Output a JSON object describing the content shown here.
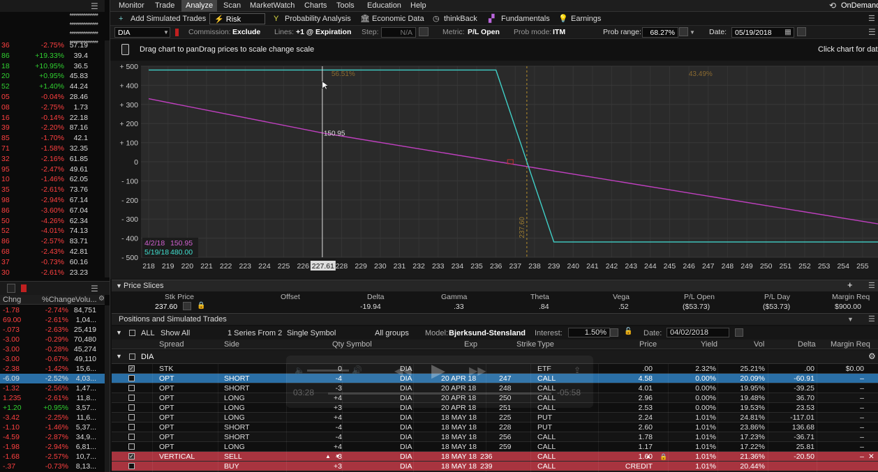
{
  "watchlist": {
    "top_rows": [
      "**************",
      "**************",
      "**************",
      "**************"
    ],
    "rows": [
      {
        "a": "36",
        "b": "-2.75%",
        "c": "57.19",
        "col": "red"
      },
      {
        "a": "86",
        "b": "+19.33%",
        "c": "39.4",
        "col": "green"
      },
      {
        "a": "18",
        "b": "+10.95%",
        "c": "36.5",
        "col": "green"
      },
      {
        "a": "20",
        "b": "+0.95%",
        "c": "45.83",
        "col": "green"
      },
      {
        "a": "52",
        "b": "+1.40%",
        "c": "44.24",
        "col": "green"
      },
      {
        "a": "05",
        "b": "-0.04%",
        "c": "28.46",
        "col": "red"
      },
      {
        "a": "08",
        "b": "-2.75%",
        "c": "1.73",
        "col": "red"
      },
      {
        "a": "16",
        "b": "-0.14%",
        "c": "22.18",
        "col": "red"
      },
      {
        "a": "39",
        "b": "-2.20%",
        "c": "87.16",
        "col": "red"
      },
      {
        "a": "85",
        "b": "-1.70%",
        "c": "42.1",
        "col": "red"
      },
      {
        "a": "71",
        "b": "-1.58%",
        "c": "32.35",
        "col": "red"
      },
      {
        "a": "32",
        "b": "-2.16%",
        "c": "61.85",
        "col": "red"
      },
      {
        "a": "95",
        "b": "-2.47%",
        "c": "49.61",
        "col": "red"
      },
      {
        "a": "10",
        "b": "-1.46%",
        "c": "62.05",
        "col": "red"
      },
      {
        "a": "35",
        "b": "-2.61%",
        "c": "73.76",
        "col": "red"
      },
      {
        "a": "98",
        "b": "-2.94%",
        "c": "67.14",
        "col": "red"
      },
      {
        "a": "86",
        "b": "-3.60%",
        "c": "67.04",
        "col": "red"
      },
      {
        "a": "50",
        "b": "-4.26%",
        "c": "62.34",
        "col": "red"
      },
      {
        "a": "52",
        "b": "-4.01%",
        "c": "74.13",
        "col": "red"
      },
      {
        "a": "86",
        "b": "-2.57%",
        "c": "83.71",
        "col": "red"
      },
      {
        "a": "68",
        "b": "-2.43%",
        "c": "42.81",
        "col": "red"
      },
      {
        "a": "37",
        "b": "-0.73%",
        "c": "60.16",
        "col": "red"
      },
      {
        "a": "30",
        "b": "-2.61%",
        "c": "23.23",
        "col": "red"
      }
    ],
    "headers": [
      "Chng",
      "%Change",
      "Volu..."
    ],
    "rows2": [
      {
        "a": "-1.78",
        "b": "-2.74%",
        "c": "84,751",
        "col": "red"
      },
      {
        "a": "69.00",
        "b": "-2.61%",
        "c": "1,04...",
        "col": "red"
      },
      {
        "a": "-.073",
        "b": "-2.63%",
        "c": "25,419",
        "col": "red"
      },
      {
        "a": "-3.00",
        "b": "-0.29%",
        "c": "70,480",
        "col": "red"
      },
      {
        "a": "-3.00",
        "b": "-0.28%",
        "c": "45,274",
        "col": "red"
      },
      {
        "a": "-3.00",
        "b": "-0.67%",
        "c": "49,110",
        "col": "red"
      },
      {
        "a": "-2.38",
        "b": "-1.42%",
        "c": "15,6...",
        "col": "red"
      },
      {
        "a": "-6.09",
        "b": "-2.52%",
        "c": "4,03...",
        "col": "red",
        "sel": true
      },
      {
        "a": "-1.32",
        "b": "-2.56%",
        "c": "1,47...",
        "col": "red"
      },
      {
        "a": "1.235",
        "b": "-2.61%",
        "c": "11,8...",
        "col": "red"
      },
      {
        "a": "+1.20",
        "b": "+0.95%",
        "c": "3,57...",
        "col": "green"
      },
      {
        "a": "-3.42",
        "b": "-2.25%",
        "c": "11,6...",
        "col": "red"
      },
      {
        "a": "-1.10",
        "b": "-1.46%",
        "c": "5,37...",
        "col": "red"
      },
      {
        "a": "-4.59",
        "b": "-2.87%",
        "c": "34,9...",
        "col": "red"
      },
      {
        "a": "-1.98",
        "b": "-2.94%",
        "c": "6,81...",
        "col": "red"
      },
      {
        "a": "-1.68",
        "b": "-2.57%",
        "c": "10,7...",
        "col": "red"
      },
      {
        "a": "-.37",
        "b": "-0.73%",
        "c": "8,13...",
        "col": "red"
      }
    ]
  },
  "menu": [
    "Monitor",
    "Trade",
    "Analyze",
    "Scan",
    "MarketWatch",
    "Charts",
    "Tools",
    "Education",
    "Help"
  ],
  "menu_active": "Analyze",
  "ondemand": "OnDemand",
  "subtabs": [
    "Add Simulated Trades",
    "Risk Profile",
    "Probability Analysis",
    "Economic Data",
    "thinkBack",
    "Fundamentals",
    "Earnings"
  ],
  "controls": {
    "symbol": "DIA",
    "commission_label": "Commission:",
    "commission_value": "Exclude",
    "lines_label": "Lines:",
    "lines_value": "+1 @ Expiration",
    "step_label": "Step:",
    "step_value": "N/A",
    "metric_label": "Metric:",
    "metric_value": "P/L Open",
    "probmode_label": "Prob mode:",
    "probmode_value": "ITM",
    "probrange_label": "Prob range:",
    "probrange_value": "68.27%",
    "date_label": "Date:",
    "date_value": "05/19/2018"
  },
  "hint": {
    "left": "Drag chart to panDrag prices to scale change scale",
    "right": "Click chart for data"
  },
  "chart_data": {
    "type": "line",
    "x_ticks": [
      218,
      219,
      220,
      221,
      222,
      223,
      224,
      225,
      226,
      227,
      228,
      229,
      230,
      231,
      232,
      233,
      234,
      235,
      236,
      237,
      238,
      239,
      240,
      241,
      242,
      243,
      244,
      245,
      246,
      247,
      248,
      249,
      250,
      251,
      252,
      253,
      254,
      255
    ],
    "y_ticks": [
      500,
      400,
      300,
      200,
      100,
      0,
      -100,
      -200,
      -300,
      -400,
      -500
    ],
    "y_tick_labels": [
      "+ 500",
      "+ 400",
      "+ 300",
      "+ 200",
      "+ 100",
      "0",
      "- 100",
      "- 200",
      "- 300",
      "- 400",
      "- 500"
    ],
    "xlim": [
      217.6,
      255.8
    ],
    "ylim": [
      -500,
      500
    ],
    "series": [
      {
        "name": "4/2/18",
        "color": "#c040c0",
        "x": [
          218,
          227,
          237.6,
          255.8
        ],
        "y": [
          330,
          150.95,
          -25,
          -325
        ]
      },
      {
        "name": "5/19/18",
        "color": "#40d0c8",
        "x": [
          218,
          236,
          239,
          255.8
        ],
        "y": [
          480,
          480,
          -420,
          -420
        ]
      }
    ],
    "cursor_x": 227,
    "cursor_x_label": "227.61",
    "cursor_value": "150.95",
    "stock_price": 237.6,
    "stock_price_label": "237.60",
    "prob_left": "56.51%",
    "prob_right": "43.49%",
    "legend": [
      {
        "date": "4/2/18",
        "value": "150.95",
        "color": "#d060d0"
      },
      {
        "date": "5/19/18",
        "value": "480.00",
        "color": "#40e0d0"
      }
    ]
  },
  "price_slices": {
    "title": "Price Slices",
    "headers": [
      "Stk Price",
      "Offset",
      "Delta",
      "Gamma",
      "Theta",
      "Vega",
      "P/L Open",
      "P/L Day",
      "Margin Req"
    ],
    "values": [
      "237.60",
      "",
      "-19.94",
      ".33",
      ".84",
      ".52",
      "($53.73)",
      "($53.73)",
      "$900.00"
    ]
  },
  "positions": {
    "title": "Positions and Simulated Trades",
    "toolbar": {
      "all": "ALL",
      "show": "Show All",
      "series": "1 Series From 2",
      "symbol": "Single Symbol",
      "groups": "All groups",
      "model_label": "Model:",
      "model_value": "Bjerksund-Stensland",
      "interest_label": "Interest:",
      "interest_value": "1.50%",
      "date_label": "Date:",
      "date_value": "04/02/2018"
    },
    "headers": [
      "Spread",
      "Side",
      "Qty",
      "Symbol",
      "Exp",
      "Strike",
      "Type",
      "Price",
      "Yield",
      "Vol",
      "Delta",
      "Margin Req"
    ],
    "group": "DIA",
    "rows": [
      {
        "spread": "STK",
        "side": "",
        "qty": "0",
        "sym": "DIA",
        "exp": "",
        "strike": "",
        "type": "ETF",
        "price": ".00",
        "yield": "2.32%",
        "vol": "25.21%",
        "delta": ".00",
        "margin": "$0.00",
        "checked": true
      },
      {
        "spread": "OPT",
        "side": "SHORT",
        "qty": "-4",
        "sym": "DIA",
        "exp": "20 APR 18",
        "strike": "247",
        "type": "CALL",
        "price": "4.58",
        "yield": "0.00%",
        "vol": "20.09%",
        "delta": "-60.91",
        "margin": "–",
        "sel": true
      },
      {
        "spread": "OPT",
        "side": "SHORT",
        "qty": "-3",
        "sym": "DIA",
        "exp": "20 APR 18",
        "strike": "248",
        "type": "CALL",
        "price": "4.01",
        "yield": "0.00%",
        "vol": "19.95%",
        "delta": "-39.25",
        "margin": "–"
      },
      {
        "spread": "OPT",
        "side": "LONG",
        "qty": "+4",
        "sym": "DIA",
        "exp": "20 APR 18",
        "strike": "250",
        "type": "CALL",
        "price": "2.96",
        "yield": "0.00%",
        "vol": "19.48%",
        "delta": "36.70",
        "margin": "–"
      },
      {
        "spread": "OPT",
        "side": "LONG",
        "qty": "+3",
        "sym": "DIA",
        "exp": "20 APR 18",
        "strike": "251",
        "type": "CALL",
        "price": "2.53",
        "yield": "0.00%",
        "vol": "19.53%",
        "delta": "23.53",
        "margin": "–"
      },
      {
        "spread": "OPT",
        "side": "LONG",
        "qty": "+4",
        "sym": "DIA",
        "exp": "18 MAY 18",
        "strike": "225",
        "type": "PUT",
        "price": "2.24",
        "yield": "1.01%",
        "vol": "24.81%",
        "delta": "-117.01",
        "margin": "–"
      },
      {
        "spread": "OPT",
        "side": "SHORT",
        "qty": "-4",
        "sym": "DIA",
        "exp": "18 MAY 18",
        "strike": "228",
        "type": "PUT",
        "price": "2.60",
        "yield": "1.01%",
        "vol": "23.86%",
        "delta": "136.68",
        "margin": "–"
      },
      {
        "spread": "OPT",
        "side": "SHORT",
        "qty": "-4",
        "sym": "DIA",
        "exp": "18 MAY 18",
        "strike": "256",
        "type": "CALL",
        "price": "1.78",
        "yield": "1.01%",
        "vol": "17.23%",
        "delta": "-36.71",
        "margin": "–"
      },
      {
        "spread": "OPT",
        "side": "LONG",
        "qty": "+4",
        "sym": "DIA",
        "exp": "18 MAY 18",
        "strike": "259",
        "type": "CALL",
        "price": "1.17",
        "yield": "1.01%",
        "vol": "17.22%",
        "delta": "25.81",
        "margin": "–"
      },
      {
        "spread": "VERTICAL",
        "side": "SELL",
        "qty": "-3",
        "sym": "DIA",
        "exp": "18 MAY 18",
        "strike": "236",
        "type": "CALL",
        "price": "1.60",
        "yield": "1.01%",
        "vol": "21.36%",
        "delta": "-20.50",
        "margin": "–",
        "sim": true,
        "checked": true
      },
      {
        "spread": "",
        "side": "BUY",
        "qty": "+3",
        "sym": "DIA",
        "exp": "18 MAY 18",
        "strike": "239",
        "type": "CALL",
        "price": "CREDIT",
        "yield": "1.01%",
        "vol": "20.44%",
        "delta": "",
        "margin": "",
        "sim": true
      }
    ]
  },
  "video": {
    "elapsed": "03:28",
    "remaining": "-05:58"
  }
}
